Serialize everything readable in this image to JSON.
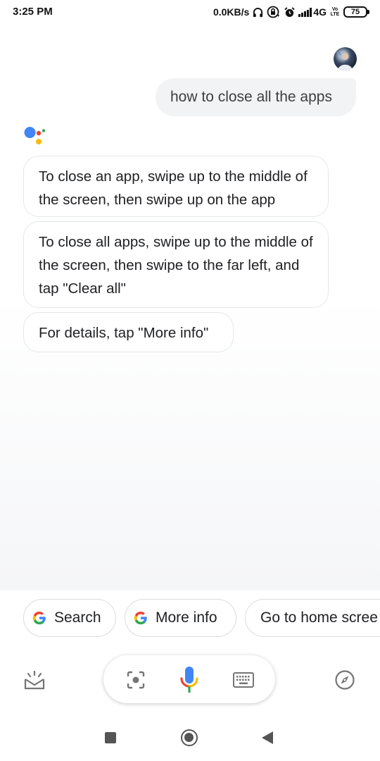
{
  "status_bar": {
    "time": "3:25 PM",
    "net_speed": "0.0KB/s",
    "network_type": "4G",
    "volte_top": "Vo",
    "volte_bottom": "LTE",
    "battery": "75",
    "icons": [
      "headphones-icon",
      "rotation-lock-icon",
      "alarm-icon",
      "signal-icon"
    ]
  },
  "conversation": {
    "user_query": "how to close all the apps",
    "responses": [
      "To close an app, swipe up to the middle of the screen, then swipe up on the app",
      "To close all apps, swipe up to the middle of the screen, then swipe to the far left, and tap \"Clear all\"",
      "For details, tap \"More info\""
    ]
  },
  "suggestions": {
    "search": "Search",
    "more_info": "More info",
    "home_screen": "Go to home scree"
  },
  "input_bar": {
    "icons": [
      "snapshot-icon",
      "lens-icon",
      "mic-icon",
      "keyboard-icon",
      "explore-icon"
    ]
  },
  "nav_bar": {
    "icons": [
      "recents-icon",
      "home-icon",
      "back-icon"
    ]
  },
  "colors": {
    "google_blue": "#4285F4",
    "google_red": "#EA4335",
    "google_yellow": "#FBBC05",
    "google_green": "#34A853",
    "icon_gray": "#757575"
  }
}
